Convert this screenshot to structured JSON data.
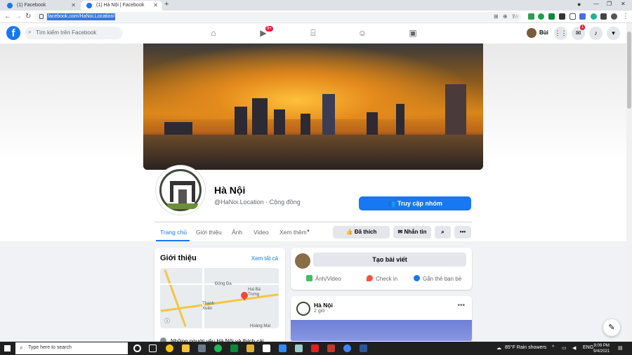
{
  "browser": {
    "tabs": [
      {
        "title": "(1) Facebook",
        "active": false
      },
      {
        "title": "(1) Hà Nội | Facebook",
        "active": true
      }
    ],
    "url": "facebook.com/HaNoi.Location/"
  },
  "fb_header": {
    "logo": "f",
    "search_placeholder": "Tìm kiếm trên Facebook",
    "nav_icons": [
      "home-icon",
      "watch-icon",
      "marketplace-icon",
      "groups-icon",
      "gaming-icon"
    ],
    "watch_badge": "9+",
    "user_name": "Bùi",
    "notif_badge": "1"
  },
  "page": {
    "name": "Hà Nội",
    "handle_category": "@HaNoi.Location · Cộng đồng",
    "primary_button": "Truy cập nhóm",
    "tabs": [
      "Trang chủ",
      "Giới thiệu",
      "Ảnh",
      "Video",
      "Xem thêm"
    ],
    "actions": {
      "liked": "Đã thích",
      "message": "Nhắn tin"
    }
  },
  "intro": {
    "title": "Giới thiệu",
    "see_all": "Xem tất cả",
    "map_labels": [
      "Đống Đa",
      "Hai Bà Trưng",
      "Thanh Xuân",
      "Hoàng Mai"
    ],
    "row_text": "Những người yêu Hà Nội và thích cái"
  },
  "composer": {
    "create_post": "Tạo bài viết",
    "photo_video": "Ảnh/Video",
    "check_in": "Check in",
    "tag_friends": "Gắn thẻ bạn bè"
  },
  "post": {
    "author": "Hà Nội",
    "time": "2 giờ ·"
  },
  "taskbar": {
    "search_placeholder": "Type here to search",
    "weather": "85°F  Rain showers",
    "lang": "ENG",
    "time": "9:09 PM",
    "date": "9/4/2021"
  },
  "colors": {
    "fb_blue": "#1877f2",
    "background": "#f0f2f5"
  }
}
